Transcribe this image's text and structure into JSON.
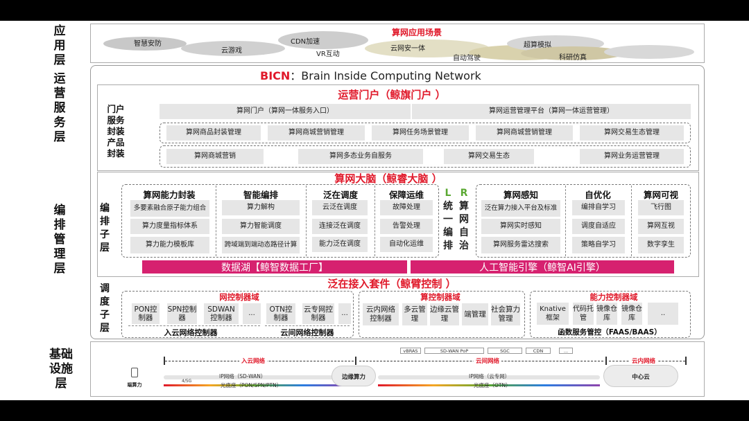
{
  "layers": {
    "app": "应用层",
    "ops": "运营服务层",
    "orch": "编排管理层",
    "infra": "基础设施层"
  },
  "app_scene": {
    "title": "算网应用场景",
    "items": [
      "智慧安防",
      "CDN加速",
      "云游戏",
      "VR互动",
      "云网安一体",
      "自动驾驶",
      "超算模拟",
      "科研仿真"
    ]
  },
  "bicn": {
    "abbr": "BICN",
    "full": "：Brain Inside Computing Network"
  },
  "portal": {
    "title": "运营门户（鲸旗门户 ）",
    "side_label_1": "门户服务",
    "side_label_2": "封装产品封装",
    "row1": [
      "算网门户（算网一体服务入口）",
      "算网运营管理平台（算网一体运营管理）"
    ],
    "row2": [
      "算网商品封装管理",
      "算网商城营销管理",
      "算网任务场景管理",
      "算网商城营销管理",
      "算网交易生态管理"
    ],
    "row3": [
      "算网商城营销",
      "算网多态业务自服务",
      "算网交易生态",
      "算网业务运营管理"
    ]
  },
  "brain": {
    "title": "算网大脑（鲸睿大脑 ）",
    "sub_layer": "编排子层",
    "columns": [
      {
        "title": "算网能力封装",
        "items": [
          "多要素融合原子能力组合",
          "算力度量指标体系",
          "算力能力模板库"
        ]
      },
      {
        "title": "智能编排",
        "items": [
          "算力解构",
          "算力智能调度",
          "跨域端到端动态路径计算"
        ]
      },
      {
        "title": "泛在调度",
        "items": [
          "云泛在调度",
          "连接泛在调度",
          "能力泛在调度"
        ]
      },
      {
        "title": "保障运维",
        "items": [
          "故障处理",
          "告警处理",
          "自动化运维"
        ]
      },
      {
        "title": "算网感知",
        "items": [
          "泛在算力接入平台及标准",
          "算网实时感知",
          "算网服务雷达搜索"
        ]
      },
      {
        "title": "自优化",
        "items": [
          "编排自学习",
          "调度自适应",
          "策略自学习"
        ]
      },
      {
        "title": "算网可视",
        "items": [
          "飞行图",
          "算网互视",
          "数字孪生"
        ]
      }
    ],
    "l_letter": "L",
    "l_text": "统一编排",
    "r_letter": "R",
    "r_text": "算网自治",
    "datalake": "数据湖【鲸智数据工厂】",
    "ai_engine": "人工智能引擎（鲸智AI引擎）"
  },
  "access": {
    "title": "泛在接入套件（鲸臂控制 ）",
    "sub_layer": "调度子层",
    "net_domain": {
      "title": "网控制器域",
      "items": [
        "PON控制器",
        "SPN控制器",
        "SDWAN控制器",
        "...",
        "OTN控制器",
        "云专网控制器",
        "..."
      ],
      "label_in": "入云网络控制器",
      "label_between": "云间网络控制器"
    },
    "compute_domain": {
      "title": "算控制器域",
      "items": [
        "云内网络控制器",
        "多云管理",
        "边缘云管理",
        "端管理",
        "社会算力管理"
      ]
    },
    "capability_domain": {
      "title": "能力控制器域",
      "items": [
        "Knative框架",
        "代码托管",
        "镜像仓库",
        "镜像仓库",
        ".."
      ],
      "footer": "函数服务管控（FAAS/BAAS）"
    }
  },
  "infra": {
    "tags": [
      "vBRAS",
      "SD-WAN PoP",
      "SGC",
      "CDN",
      "..."
    ],
    "seg_in": "入云网络",
    "seg_between": "云间网络",
    "seg_inner": "云内网络",
    "ip_in": "IP网络（SD-WAN）",
    "opt_in": "光底座（PON/SPN/PTN）",
    "ip_between": "IP网络（云专网）",
    "opt_between": "光底座（OTN）",
    "edge": "边缘算力",
    "center": "中心云",
    "device": "端算力",
    "g45": "4/5G"
  },
  "colors": {
    "red": "#e0192a",
    "pink": "#d6216f",
    "gray": "#e6e6e6",
    "border": "#999999"
  }
}
